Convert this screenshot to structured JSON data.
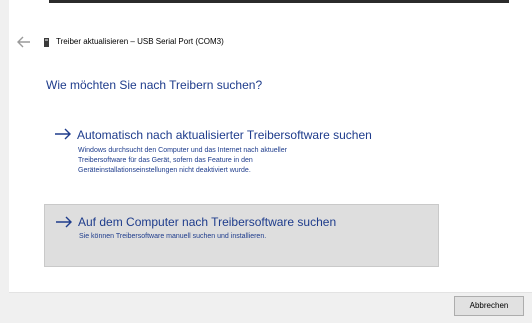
{
  "window": {
    "close_glyph": "×"
  },
  "header": {
    "title": "Treiber aktualisieren – USB Serial Port (COM3)"
  },
  "main": {
    "question": "Wie möchten Sie nach Treibern suchen?",
    "options": [
      {
        "title": "Automatisch nach aktualisierter Treibersoftware suchen",
        "description_lines": [
          "Windows durchsucht den Computer und das Internet nach aktueller",
          "Treibersoftware für das Gerät, sofern das Feature in den",
          "Geräteinstallationseinstellungen nicht deaktiviert wurde."
        ]
      },
      {
        "title": "Auf dem Computer nach Treibersoftware suchen",
        "description_lines": [
          "Sie können Treibersoftware manuell suchen und installieren."
        ]
      }
    ]
  },
  "footer": {
    "cancel_label": "Abbrechen"
  },
  "colors": {
    "accent_blue": "#1e3c8c",
    "hover_background": "#dedede"
  },
  "icons": {
    "back": "back-arrow-icon",
    "device": "usb-device-icon",
    "option_arrow": "right-arrow-icon",
    "close": "close-icon"
  }
}
